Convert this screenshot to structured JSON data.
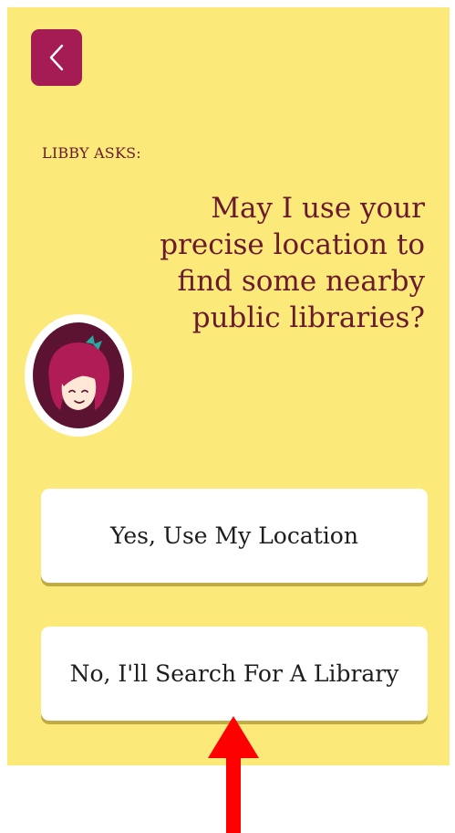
{
  "header": {
    "back_icon": "chevron-left-icon",
    "back_button_color": "#a51b54"
  },
  "prompt": {
    "asker_label": "LIBBY ASKS:",
    "question": "May I use your precise location to find some nearby public libraries?",
    "avatar_icon": "libby-mascot-icon"
  },
  "actions": {
    "yes_label": "Yes, Use My Location",
    "no_label": "No, I'll Search For A Library"
  },
  "annotation": {
    "arrow_icon": "red-arrow-up-icon",
    "arrow_color": "#ff0000"
  },
  "colors": {
    "background": "#fbe97a",
    "text": "#6a1a2d",
    "button_shadow": "#c1ab44"
  }
}
